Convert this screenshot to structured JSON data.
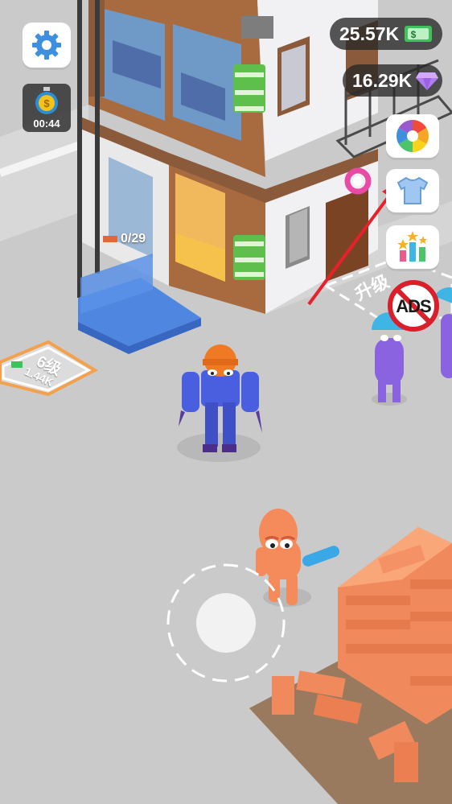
{
  "hud": {
    "cash_value": "25.57K",
    "gem_value": "16.29K",
    "timer_value": "00:44"
  },
  "world": {
    "counter_text": "0/29",
    "upgrade_zone_text": "升级",
    "level_zone_title": "6级",
    "level_zone_cost": "1.44K"
  },
  "side_buttons": {
    "no_ads_label": "ADS"
  },
  "colors": {
    "hud_bg": "#2f2f2f",
    "cash_green": "#3fc15b",
    "gem_purple": "#b07cf0",
    "ground": "#cacaca",
    "brick": "#f08a5d",
    "player_orange": "#f58a5a",
    "robot_blue": "#4a5fe0",
    "worker_purple": "#8a63e0",
    "arrow_red": "#e8202a"
  },
  "icons": [
    "gear-icon",
    "stopwatch-icon",
    "cash-icon",
    "gem-icon",
    "lucky-wheel-icon",
    "shirt-icon",
    "leaderboard-icon",
    "no-ads-icon"
  ]
}
